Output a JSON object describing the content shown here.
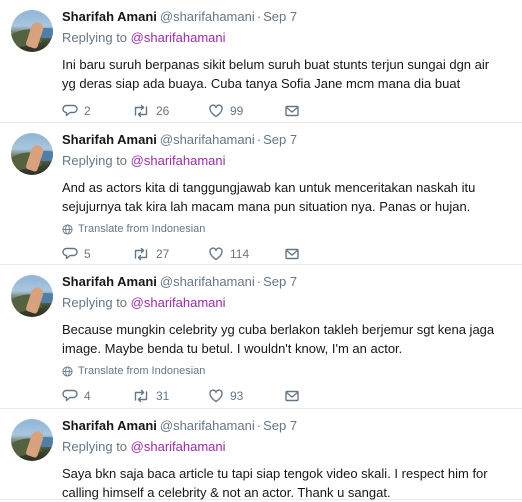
{
  "tweets": [
    {
      "name": "Sharifah Amani",
      "handle": "@sharifahamani",
      "time": "Sep 7",
      "replying_prefix": "Replying to",
      "replying_to": "@sharifahamani",
      "text": "Ini baru suruh berpanas sikit belum suruh buat stunts terjun sungai dgn air yg deras siap ada buaya. Cuba tanya Sofia Jane mcm mana dia buat",
      "translate": "",
      "replies": "2",
      "retweets": "26",
      "likes": "99"
    },
    {
      "name": "Sharifah Amani",
      "handle": "@sharifahamani",
      "time": "Sep 7",
      "replying_prefix": "Replying to",
      "replying_to": "@sharifahamani",
      "text": "And as actors kita di tanggungjawab kan untuk menceritakan naskah itu sejujurnya tak kira lah macam mana pun situation nya. Panas or hujan.",
      "translate": "Translate from Indonesian",
      "replies": "5",
      "retweets": "27",
      "likes": "114"
    },
    {
      "name": "Sharifah Amani",
      "handle": "@sharifahamani",
      "time": "Sep 7",
      "replying_prefix": "Replying to",
      "replying_to": "@sharifahamani",
      "text": "Because mungkin celebrity yg cuba berlakon takleh berjemur sgt kena jaga image. Maybe benda tu betul. I wouldn't know, I'm an actor.",
      "translate": "Translate from Indonesian",
      "replies": "4",
      "retweets": "31",
      "likes": "93"
    },
    {
      "name": "Sharifah Amani",
      "handle": "@sharifahamani",
      "time": "Sep 7",
      "replying_prefix": "Replying to",
      "replying_to": "@sharifahamani",
      "text": "Saya bkn saja baca article tu tapi siap tengok video skali. I respect him for calling himself a celebrity & not an actor. Thank u sangat.",
      "translate": "",
      "replies": "",
      "retweets": "",
      "likes": ""
    }
  ],
  "sep": "·",
  "icons": {
    "reply": "reply-icon",
    "retweet": "retweet-icon",
    "like": "heart-icon",
    "message": "envelope-icon",
    "translate": "globe-icon"
  },
  "colors": {
    "mention": "#9b2da8",
    "muted": "#657786",
    "divider": "#e6ecf0"
  }
}
